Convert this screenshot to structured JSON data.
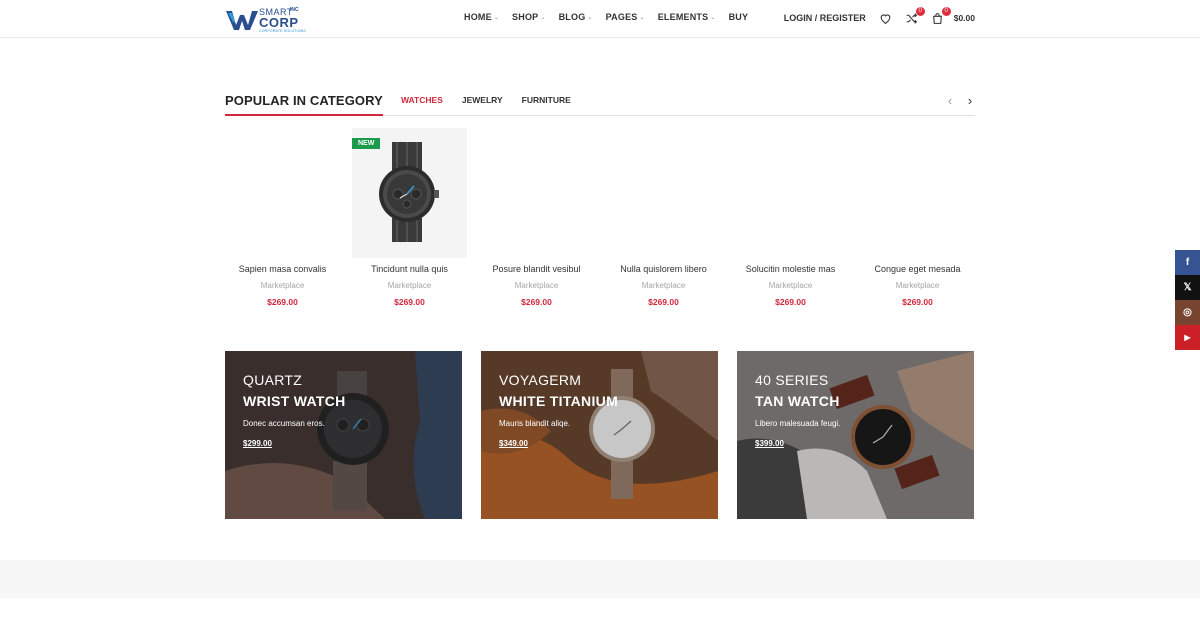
{
  "header": {
    "logo": {
      "line1": "SMART",
      "line2": "CORP",
      "super": "INC",
      "tagline": "CORPORATE SOLUTIONS"
    },
    "nav": [
      {
        "label": "HOME",
        "caret": "⌄"
      },
      {
        "label": "SHOP",
        "caret": "⌄"
      },
      {
        "label": "BLOG",
        "caret": "⌄"
      },
      {
        "label": "PAGES",
        "caret": "⌄"
      },
      {
        "label": "ELEMENTS",
        "caret": "⌄"
      },
      {
        "label": "BUY",
        "caret": ""
      }
    ],
    "login_label": "LOGIN / REGISTER",
    "compare_count": "0",
    "cart_count": "0",
    "cart_total": "$0.00"
  },
  "section": {
    "title": "POPULAR IN CATEGORY",
    "tabs": [
      "WATCHES",
      "JEWELRY",
      "FURNITURE"
    ],
    "active_tab": "WATCHES"
  },
  "products": [
    {
      "name": "Sapien masa convalis",
      "category": "Marketplace",
      "price": "$269.00",
      "badge": ""
    },
    {
      "name": "Tincidunt nulla quis",
      "category": "Marketplace",
      "price": "$269.00",
      "badge": "NEW"
    },
    {
      "name": "Posure blandit vesibul",
      "category": "Marketplace",
      "price": "$269.00",
      "badge": ""
    },
    {
      "name": "Nulla quislorem libero",
      "category": "Marketplace",
      "price": "$269.00",
      "badge": ""
    },
    {
      "name": "Solucitin molestie mas",
      "category": "Marketplace",
      "price": "$269.00",
      "badge": ""
    },
    {
      "name": "Congue eget mesada",
      "category": "Marketplace",
      "price": "$269.00",
      "badge": ""
    }
  ],
  "banners": [
    {
      "subtitle": "QUARTZ",
      "title": "WRIST WATCH",
      "description": "Donec accumsan eros.",
      "price": "$299.00"
    },
    {
      "subtitle": "VOYAGERM",
      "title": "WHITE TITANIUM",
      "description": "Mauris blandit aliqe.",
      "price": "$349.00"
    },
    {
      "subtitle": "40 SERIES",
      "title": "TAN WATCH",
      "description": "Libero malesuada feugi.",
      "price": "$399.00"
    }
  ],
  "social": [
    {
      "name": "facebook",
      "glyph": "f",
      "color": "#365493"
    },
    {
      "name": "x",
      "glyph": "𝕏",
      "color": "#111111"
    },
    {
      "name": "instagram",
      "glyph": "◎",
      "color": "#774430"
    },
    {
      "name": "youtube",
      "glyph": "▶",
      "color": "#cb2027"
    }
  ],
  "colors": {
    "accent": "#d0283c",
    "new_badge": "#1a9a4a",
    "logo_blue": "#2a4d8f"
  }
}
